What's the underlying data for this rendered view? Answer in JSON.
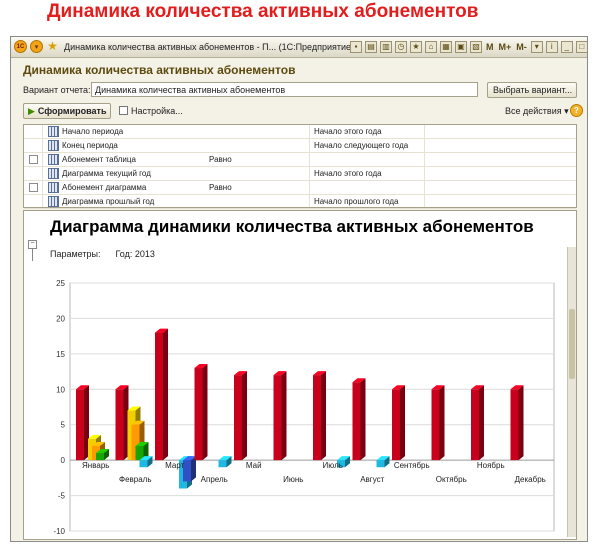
{
  "page_heading": "Динамика количества активных абонементов",
  "window": {
    "title": "Динамика количества активных абонементов - П... (1С:Предприятие)",
    "memory_buttons": [
      "M",
      "M+",
      "M-"
    ]
  },
  "form": {
    "title": "Динамика количества активных абонементов",
    "variant_label": "Вариант отчета:",
    "variant_value": "Динамика количества активных абонементов",
    "select_variant_button": "Выбрать вариант...",
    "generate_button": "Сформировать",
    "settings_button": "Настройка...",
    "all_actions": "Все действия",
    "help_symbol": "?"
  },
  "parameters": [
    {
      "name": "Начало периода",
      "comparison": "",
      "value": "Начало этого года",
      "checkbox": false
    },
    {
      "name": "Конец периода",
      "comparison": "",
      "value": "Начало следующего года",
      "checkbox": false
    },
    {
      "name": "Абонемент таблица",
      "comparison": "Равно",
      "value": "",
      "checkbox": true
    },
    {
      "name": "Диаграмма текущий год",
      "comparison": "",
      "value": "Начало этого года",
      "checkbox": false
    },
    {
      "name": "Абонемент диаграмма",
      "comparison": "Равно",
      "value": "",
      "checkbox": true
    },
    {
      "name": "Диаграмма прошлый год",
      "comparison": "",
      "value": "Начало прошлого года",
      "checkbox": false
    }
  ],
  "report": {
    "title": "Диаграмма динамики количества активных абонементов",
    "params_label": "Параметры:",
    "params_value": "Год: 2013"
  },
  "colors": {
    "main_series": "#c8001c",
    "accent": "#e31c1c",
    "brand_bar": "#dcd8c6"
  },
  "chart_data": {
    "type": "bar",
    "title": "",
    "xlabel": "",
    "ylabel": "",
    "ylim": [
      -10,
      25
    ],
    "yticks": [
      -10,
      -5,
      0,
      5,
      10,
      15,
      20,
      25
    ],
    "grid": true,
    "categories": [
      "Январь",
      "Февраль",
      "Март",
      "Апрель",
      "Май",
      "Июнь",
      "Июль",
      "Август",
      "Сентябрь",
      "Октябрь",
      "Ноябрь",
      "Декабрь"
    ],
    "series": [
      {
        "color": "#c8001c",
        "values": [
          10,
          10,
          18,
          13,
          12,
          12,
          12,
          11,
          10,
          10,
          10,
          10
        ]
      },
      {
        "color": "#f2cf00",
        "values": [
          3,
          7,
          0,
          0,
          0,
          0,
          0,
          0,
          0,
          0,
          0,
          0
        ]
      },
      {
        "color": "#ff9a00",
        "values": [
          2,
          5,
          0,
          0,
          0,
          0,
          0,
          0,
          0,
          0,
          0,
          0
        ]
      },
      {
        "color": "#17a500",
        "values": [
          1,
          2,
          0,
          0,
          0,
          0,
          0,
          0,
          0,
          0,
          0,
          0
        ]
      },
      {
        "color": "#1fb8e0",
        "values": [
          0,
          -1,
          -4,
          -1,
          0,
          0,
          -1,
          -1,
          0,
          0,
          0,
          0
        ]
      },
      {
        "color": "#3050c8",
        "values": [
          0,
          0,
          -3,
          0,
          0,
          0,
          0,
          0,
          0,
          0,
          0,
          0
        ]
      }
    ]
  }
}
